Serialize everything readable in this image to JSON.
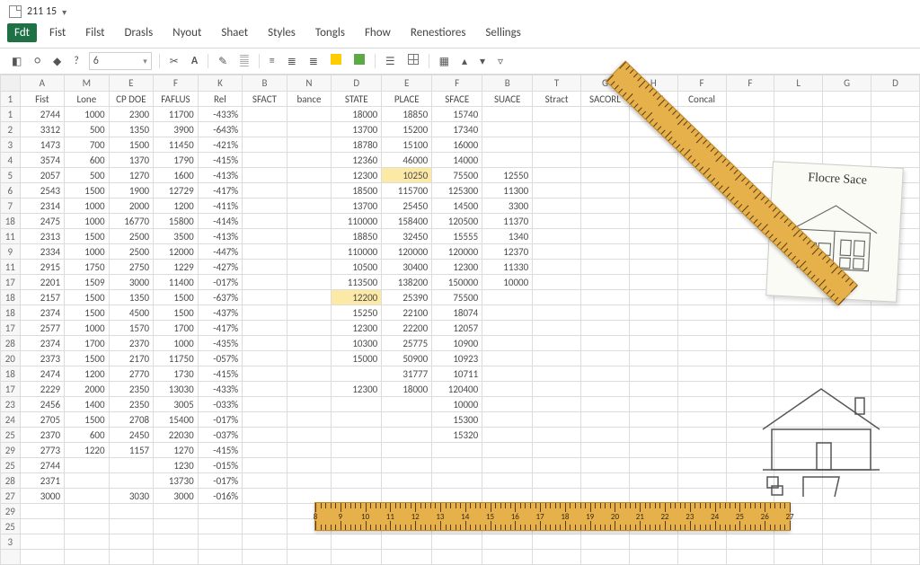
{
  "title": "211 15",
  "menu": {
    "items": [
      "Fdt",
      "Fist",
      "Filst",
      "Drasls",
      "Nyout",
      "Shaet",
      "Styles",
      "Tongls",
      "Fhow",
      "Renestiores",
      "Sellings"
    ],
    "active_index": 0
  },
  "toolbar": {
    "fontsize": "6"
  },
  "columns": [
    "A",
    "M",
    "E",
    "F",
    "K",
    "B",
    "N",
    "D",
    "E",
    "F",
    "B",
    "T",
    "G",
    "H",
    "F",
    "F",
    "L",
    "G",
    "D"
  ],
  "header_row": [
    "Fist",
    "Lone",
    "CP DOE",
    "FAFLUS",
    "Rel",
    "SFACT",
    "bance",
    "STATE",
    "PLACE",
    "SFACE",
    "SUACE",
    "Stract",
    "SACORL",
    "Shact",
    "Concal",
    "",
    "",
    "",
    ""
  ],
  "row_numbers": [
    "1",
    "1",
    "2",
    "3",
    "4",
    "5",
    "6",
    "7",
    "18",
    "11",
    "9",
    "11",
    "17",
    "18",
    "18",
    "17",
    "28",
    "20",
    "18",
    "17",
    "23",
    "24",
    "25",
    "29",
    "25",
    "28",
    "27",
    "29",
    "25",
    "3"
  ],
  "rows": [
    [
      "2744",
      "1000",
      "2300",
      "11700",
      "-433%",
      "",
      "",
      "18000",
      "18850",
      "15740",
      "",
      "",
      "",
      "",
      "",
      "",
      "",
      "",
      ""
    ],
    [
      "3312",
      "500",
      "1350",
      "3900",
      "-643%",
      "",
      "",
      "13700",
      "15200",
      "17340",
      "",
      "",
      "",
      "",
      "",
      "",
      "",
      "",
      ""
    ],
    [
      "1473",
      "700",
      "1500",
      "11450",
      "-421%",
      "",
      "",
      "18780",
      "15100",
      "16000",
      "",
      "",
      "",
      "",
      "",
      "",
      "",
      "",
      ""
    ],
    [
      "3574",
      "600",
      "1370",
      "1790",
      "-415%",
      "",
      "",
      "12360",
      "46000",
      "14000",
      "",
      "",
      "",
      "",
      "",
      "",
      "",
      "",
      ""
    ],
    [
      "2057",
      "500",
      "1270",
      "1600",
      "-413%",
      "",
      "",
      "12300",
      "10250",
      "75500",
      "12550",
      "",
      "",
      "",
      "",
      "",
      "",
      "",
      ""
    ],
    [
      "2543",
      "1500",
      "1900",
      "12729",
      "-417%",
      "",
      "",
      "18500",
      "115700",
      "125300",
      "11300",
      "",
      "",
      "",
      "",
      "",
      "",
      "",
      ""
    ],
    [
      "2314",
      "1000",
      "2000",
      "1200",
      "-411%",
      "",
      "",
      "13700",
      "25450",
      "14500",
      "3300",
      "",
      "",
      "",
      "",
      "",
      "",
      "",
      ""
    ],
    [
      "2475",
      "1000",
      "16770",
      "15800",
      "-414%",
      "",
      "",
      "110000",
      "158400",
      "120500",
      "11370",
      "",
      "",
      "",
      "",
      "",
      "",
      "",
      ""
    ],
    [
      "2313",
      "1500",
      "2500",
      "3500",
      "-413%",
      "",
      "",
      "18850",
      "32450",
      "15555",
      "1340",
      "",
      "",
      "",
      "",
      "",
      "",
      "",
      ""
    ],
    [
      "2334",
      "1000",
      "2500",
      "12000",
      "-447%",
      "",
      "",
      "110000",
      "120000",
      "120000",
      "12370",
      "",
      "",
      "",
      "",
      "",
      "",
      "",
      ""
    ],
    [
      "2915",
      "1750",
      "2750",
      "1229",
      "-427%",
      "",
      "",
      "10500",
      "30400",
      "12300",
      "11330",
      "",
      "",
      "",
      "",
      "",
      "",
      "",
      ""
    ],
    [
      "2201",
      "1509",
      "3000",
      "11400",
      "-017%",
      "",
      "",
      "113500",
      "138200",
      "150000",
      "10000",
      "",
      "",
      "",
      "",
      "",
      "",
      "",
      ""
    ],
    [
      "2157",
      "1500",
      "1350",
      "1500",
      "-637%",
      "",
      "",
      "12200",
      "25390",
      "75500",
      "",
      "",
      "",
      "",
      "",
      "",
      "",
      "",
      ""
    ],
    [
      "2374",
      "1500",
      "4500",
      "1500",
      "-437%",
      "",
      "",
      "15250",
      "22100",
      "18074",
      "",
      "",
      "",
      "",
      "",
      "",
      "",
      "",
      ""
    ],
    [
      "2577",
      "1000",
      "1570",
      "1700",
      "-417%",
      "",
      "",
      "12300",
      "22200",
      "12057",
      "",
      "",
      "",
      "",
      "",
      "",
      "",
      "",
      ""
    ],
    [
      "2374",
      "1700",
      "2370",
      "1000",
      "-435%",
      "",
      "",
      "10300",
      "25775",
      "10900",
      "",
      "",
      "",
      "",
      "",
      "",
      "",
      "",
      ""
    ],
    [
      "2373",
      "1500",
      "2170",
      "11750",
      "-057%",
      "",
      "",
      "15000",
      "50900",
      "10923",
      "",
      "",
      "",
      "",
      "",
      "",
      "",
      "",
      ""
    ],
    [
      "2474",
      "1200",
      "2770",
      "1730",
      "-415%",
      "",
      "",
      "",
      "31777",
      "10711",
      "",
      "",
      "",
      "",
      "",
      "",
      "",
      "",
      ""
    ],
    [
      "2229",
      "2000",
      "2350",
      "13030",
      "-433%",
      "",
      "",
      "12300",
      "18000",
      "120400",
      "",
      "",
      "",
      "",
      "",
      "",
      "",
      "",
      ""
    ],
    [
      "2456",
      "1400",
      "2350",
      "3005",
      "-033%",
      "",
      "",
      "",
      "",
      "10000",
      "",
      "",
      "",
      "",
      "",
      "",
      "",
      "",
      ""
    ],
    [
      "2705",
      "1500",
      "2708",
      "15400",
      "-017%",
      "",
      "",
      "",
      "",
      "15300",
      "",
      "",
      "",
      "",
      "",
      "",
      "",
      "",
      ""
    ],
    [
      "2370",
      "600",
      "2450",
      "22030",
      "-037%",
      "",
      "",
      "",
      "",
      "15320",
      "",
      "",
      "",
      "",
      "",
      "",
      "",
      "",
      ""
    ],
    [
      "2773",
      "1220",
      "1157",
      "1270",
      "-415%",
      "",
      "",
      "",
      "",
      "",
      "",
      "",
      "",
      "",
      "",
      "",
      "",
      "",
      ""
    ],
    [
      "2744",
      "",
      "",
      "1230",
      "-015%",
      "",
      "",
      "",
      "",
      "",
      "",
      "",
      "",
      "",
      "",
      "",
      "",
      "",
      ""
    ],
    [
      "2371",
      "",
      "",
      "13730",
      "-017%",
      "",
      "",
      "",
      "",
      "",
      "",
      "",
      "",
      "",
      "",
      "",
      "",
      "",
      ""
    ],
    [
      "3000",
      "",
      "3030",
      "3000",
      "-016%",
      "",
      "",
      "",
      "",
      "",
      "",
      "",
      "",
      "",
      "",
      "",
      "",
      "",
      ""
    ],
    [
      "",
      "",
      "",
      "",
      "",
      "",
      "",
      "",
      "",
      "",
      "",
      "",
      "",
      "",
      "",
      "",
      "",
      "",
      ""
    ],
    [
      "",
      "",
      "",
      "",
      "",
      "",
      "",
      "",
      "",
      "",
      "",
      "",
      "",
      "",
      "",
      "",
      "",
      "",
      ""
    ],
    [
      "",
      "",
      "",
      "",
      "",
      "",
      "",
      "",
      "",
      "",
      "",
      "",
      "",
      "",
      "",
      "",
      "",
      "",
      ""
    ],
    [
      "",
      "",
      "",
      "",
      "",
      "",
      "",
      "",
      "",
      "",
      "",
      "",
      "",
      "",
      "",
      "",
      "",
      "",
      ""
    ]
  ],
  "highlights": [
    {
      "row": 4,
      "col": 9
    },
    {
      "row": 12,
      "col": 8
    }
  ],
  "sticky_title": "Flocre Sace"
}
